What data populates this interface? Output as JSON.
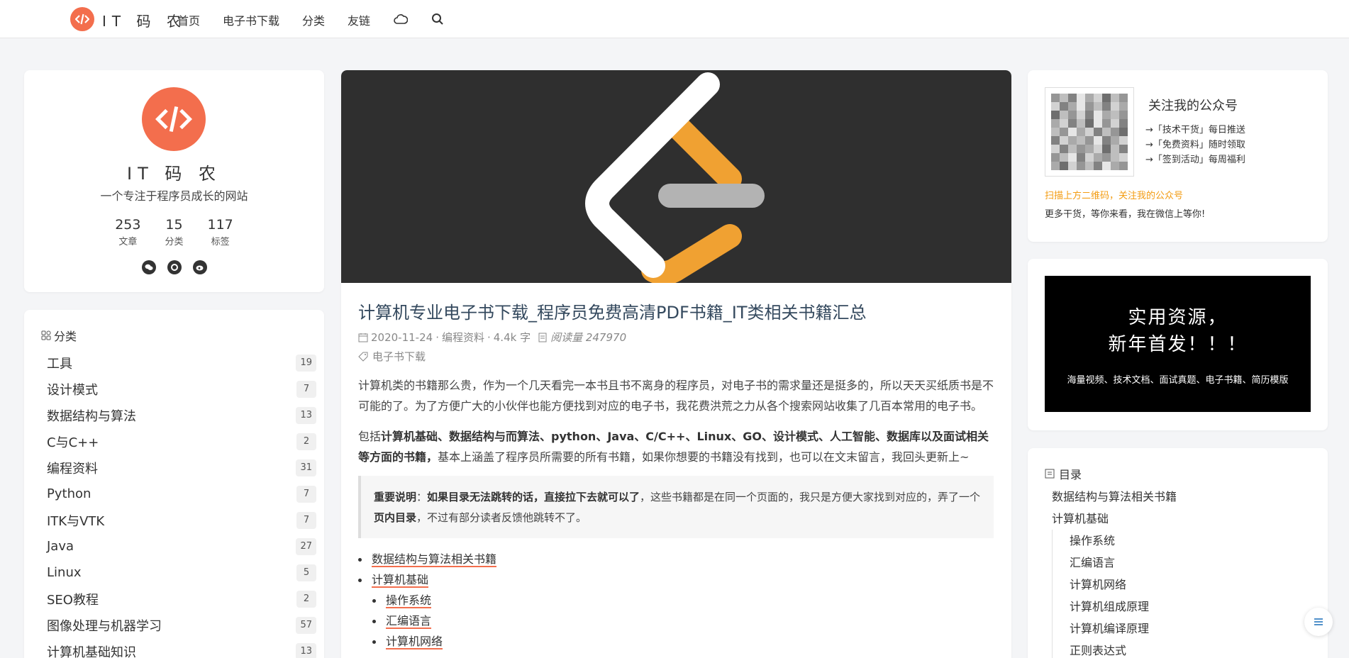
{
  "header": {
    "logo_text": "IT 码 农",
    "nav": [
      "首页",
      "电子书下载",
      "分类",
      "友链"
    ],
    "icons": [
      "cloud-icon",
      "search-icon"
    ]
  },
  "profile": {
    "name": "IT 码 农",
    "tagline": "一个专注于程序员成长的网站",
    "stats": [
      {
        "num": "253",
        "label": "文章"
      },
      {
        "num": "15",
        "label": "分类"
      },
      {
        "num": "117",
        "label": "标签"
      }
    ],
    "socials": [
      "wechat-icon",
      "github-icon",
      "weibo-icon"
    ]
  },
  "categories": {
    "title": "分类",
    "items": [
      {
        "name": "工具",
        "count": "19"
      },
      {
        "name": "设计模式",
        "count": "7"
      },
      {
        "name": "数据结构与算法",
        "count": "13"
      },
      {
        "name": "C与C++",
        "count": "2"
      },
      {
        "name": "编程资料",
        "count": "31"
      },
      {
        "name": "Python",
        "count": "7"
      },
      {
        "name": "ITK与VTK",
        "count": "7"
      },
      {
        "name": "Java",
        "count": "27"
      },
      {
        "name": "Linux",
        "count": "5"
      },
      {
        "name": "SEO教程",
        "count": "2"
      },
      {
        "name": "图像处理与机器学习",
        "count": "57"
      },
      {
        "name": "计算机基础知识",
        "count": "13"
      }
    ]
  },
  "article": {
    "title": "计算机专业电子书下载_程序员免费高清PDF书籍_IT类相关书籍汇总",
    "date": "2020-11-24",
    "category": "编程资料",
    "words": "4.4k 字",
    "reads": "阅读量 247970",
    "tag": "电子书下载",
    "p1": "计算机类的书籍那么贵，作为一个几天看完一本书且书不离身的程序员，对电子书的需求量还是挺多的，所以天天买纸质书是不可能的了。为了方便广大的小伙伴也能方便找到对应的电子书，我花费洪荒之力从各个搜索网站收集了几百本常用的电子书。",
    "p2_prefix": "包括",
    "p2_bold": "计算机基础、数据结构与而算法、python、Java、C/C++、Linux、GO、设计模式、人工智能、数据库以及面试相关等方面的书籍，",
    "p2_rest": "基本上涵盖了程序员所需要的所有书籍，如果你想要的书籍没有找到，也可以在文末留言，我回头更新上~",
    "notice_label": "重要说明",
    "notice_colon": "：",
    "notice_bold": "如果目录无法跳转的话，直接拉下去就可以了",
    "notice_text1": "，这些书籍都是在同一个页面的，我只是方便大家找到对应的，弄了一个",
    "notice_bold2": "页内目录",
    "notice_text2": "，不过有部分读者反馈他跳转不了。",
    "links": [
      {
        "text": "数据结构与算法相关书籍",
        "sub": false
      },
      {
        "text": "计算机基础",
        "sub": false
      },
      {
        "text": "操作系统",
        "sub": true
      },
      {
        "text": "汇编语言",
        "sub": true
      },
      {
        "text": "计算机网络",
        "sub": true
      }
    ]
  },
  "qr": {
    "title": "关注我的公众号",
    "lines": [
      "→「技术干货」每日推送",
      "→「免费资料」随时领取",
      "→「签到活动」每周福利"
    ],
    "note1": "扫描上方二维码，关注我的公众号",
    "note2": "更多干货，等你来看，我在微信上等你!"
  },
  "promo": {
    "line1": "实用资源，",
    "line2": "新年首发！！！",
    "line3": "海量视频、技术文档、面试真题、电子书籍、简历模版"
  },
  "toc": {
    "title": "目录",
    "items": [
      {
        "text": "数据结构与算法相关书籍",
        "level": 1
      },
      {
        "text": "计算机基础",
        "level": 1
      },
      {
        "text": "操作系统",
        "level": 2
      },
      {
        "text": "汇编语言",
        "level": 2
      },
      {
        "text": "计算机网络",
        "level": 2
      },
      {
        "text": "计算机组成原理",
        "level": 2
      },
      {
        "text": "计算机编译原理",
        "level": 2
      },
      {
        "text": "正则表达式",
        "level": 2
      }
    ]
  },
  "colors": {
    "accent": "#f36e4d",
    "banner_bg": "#2f2f2f",
    "orange": "#f0a132"
  }
}
